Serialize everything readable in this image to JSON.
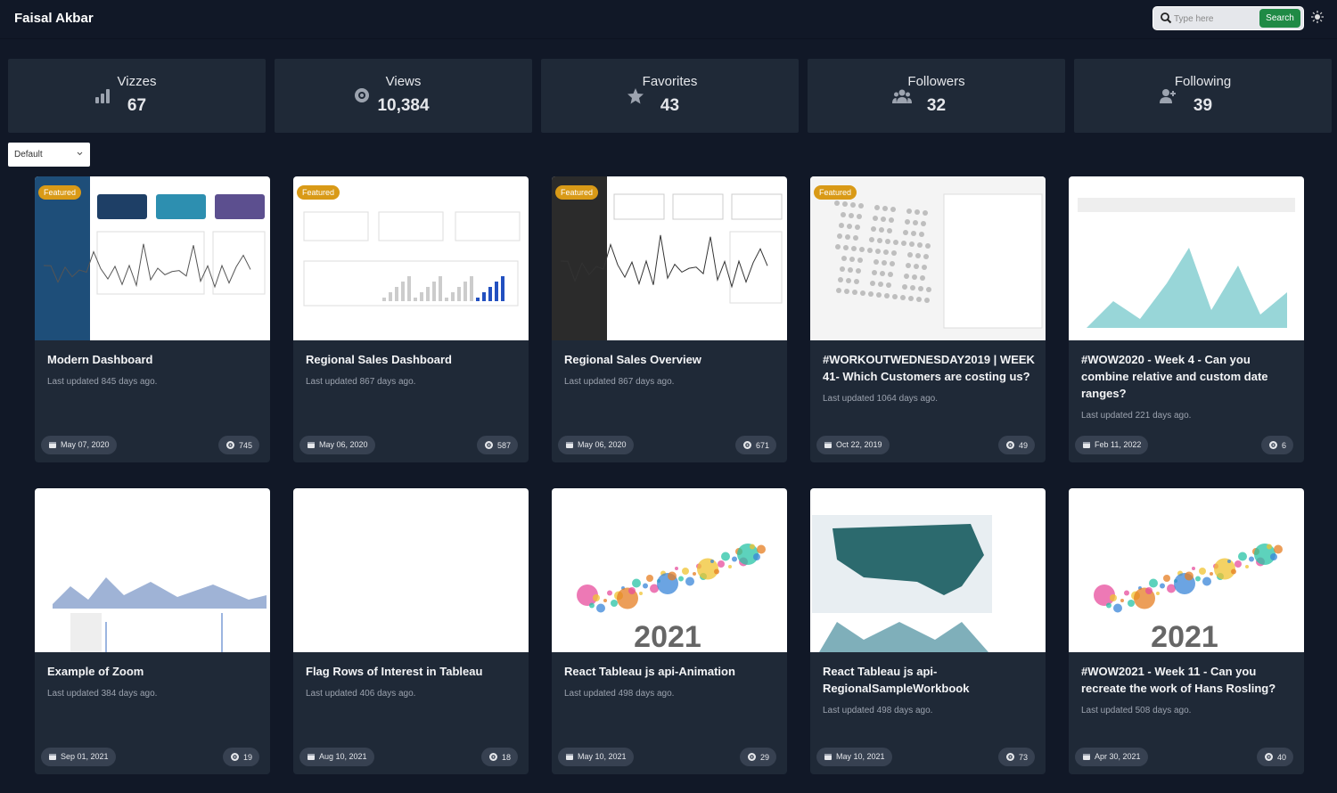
{
  "header": {
    "title": "Faisal Akbar",
    "search_placeholder": "Type here",
    "search_button": "Search"
  },
  "stats": [
    {
      "label": "Vizzes",
      "value": "67",
      "icon": "bar-chart-icon"
    },
    {
      "label": "Views",
      "value": "10,384",
      "icon": "eye-icon"
    },
    {
      "label": "Favorites",
      "value": "43",
      "icon": "star-icon"
    },
    {
      "label": "Followers",
      "value": "32",
      "icon": "users-icon"
    },
    {
      "label": "Following",
      "value": "39",
      "icon": "user-plus-icon"
    }
  ],
  "sort": {
    "selected": "Default"
  },
  "featured_label": "Featured",
  "cards": [
    {
      "title": "Modern Dashboard",
      "updated": "Last updated 845 days ago.",
      "date": "May 07, 2020",
      "views": "745",
      "featured": true,
      "thumb": "dark"
    },
    {
      "title": "Regional Sales Dashboard",
      "updated": "Last updated 867 days ago.",
      "date": "May 06, 2020",
      "views": "587",
      "featured": true,
      "thumb": "bars"
    },
    {
      "title": "Regional Sales Overview",
      "updated": "Last updated 867 days ago.",
      "date": "May 06, 2020",
      "views": "671",
      "featured": true,
      "thumb": "dark2"
    },
    {
      "title": "#WORKOUTWEDNESDAY2019 | WEEK 41- Which Customers are costing us?",
      "updated": "Last updated 1064 days ago.",
      "date": "Oct 22, 2019",
      "views": "49",
      "featured": true,
      "thumb": "scatter"
    },
    {
      "title": "#WOW2020 - Week 4 - Can you combine relative and custom date ranges?",
      "updated": "Last updated 221 days ago.",
      "date": "Feb 11, 2022",
      "views": "6",
      "featured": false,
      "thumb": "area"
    },
    {
      "title": "Example of Zoom",
      "updated": "Last updated 384 days ago.",
      "date": "Sep 01, 2021",
      "views": "19",
      "featured": false,
      "thumb": "zoom"
    },
    {
      "title": "Flag Rows of Interest in Tableau",
      "updated": "Last updated 406 days ago.",
      "date": "Aug 10, 2021",
      "views": "18",
      "featured": false,
      "thumb": "blank"
    },
    {
      "title": "React Tableau js api-Animation",
      "updated": "Last updated 498 days ago.",
      "date": "May 10, 2021",
      "views": "29",
      "featured": false,
      "thumb": "bubble"
    },
    {
      "title": "React Tableau js api-RegionalSampleWorkbook",
      "updated": "Last updated 498 days ago.",
      "date": "May 10, 2021",
      "views": "73",
      "featured": false,
      "thumb": "map"
    },
    {
      "title": "#WOW2021 - Week 11 - Can you recreate the work of Hans Rosling?",
      "updated": "Last updated 508 days ago.",
      "date": "Apr 30, 2021",
      "views": "40",
      "featured": false,
      "thumb": "bubble"
    }
  ],
  "colors": {
    "background": "#111827",
    "card": "#1f2937",
    "pill": "#374151",
    "featured": "#d99a17",
    "search_button": "#1f8a45"
  }
}
